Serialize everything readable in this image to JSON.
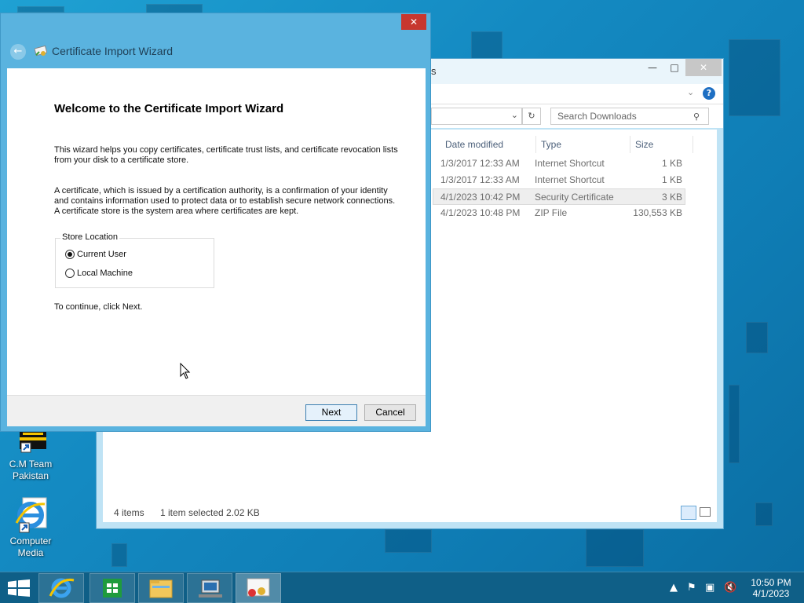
{
  "desktop": {
    "icons": [
      {
        "label_line1": "C.M Team",
        "label_line2": "Pakistan"
      },
      {
        "label_line1": "Computer",
        "label_line2": "Media"
      }
    ]
  },
  "explorer": {
    "title_fragment": "s",
    "search_placeholder": "Search Downloads",
    "columns": [
      "Date modified",
      "Type",
      "Size"
    ],
    "files": [
      {
        "date": "1/3/2017 12:33 AM",
        "type": "Internet Shortcut",
        "size": "1 KB"
      },
      {
        "date": "1/3/2017 12:33 AM",
        "type": "Internet Shortcut",
        "size": "1 KB"
      },
      {
        "date": "4/1/2023 10:42 PM",
        "type": "Security Certificate",
        "size": "3 KB"
      },
      {
        "date": "4/1/2023 10:48 PM",
        "type": "ZIP File",
        "size": "130,553 KB"
      }
    ],
    "status": {
      "items": "4 items",
      "selection": "1 item selected  2.02 KB"
    }
  },
  "wizard": {
    "title": "Certificate Import Wizard",
    "heading": "Welcome to the Certificate Import Wizard",
    "para1": "This wizard helps you copy certificates, certificate trust lists, and certificate revocation lists from your disk to a certificate store.",
    "para2": "A certificate, which is issued by a certification authority, is a confirmation of your identity and contains information used to protect data or to establish secure network connections. A certificate store is the system area where certificates are kept.",
    "store_location_label": "Store Location",
    "options": [
      "Current User",
      "Local Machine"
    ],
    "selected_option": "Current User",
    "continue_text": "To continue, click Next.",
    "next_label": "Next",
    "cancel_label": "Cancel"
  },
  "taskbar": {
    "time": "10:50 PM",
    "date": "4/1/2023"
  },
  "colors": {
    "desktop": "#148ac2",
    "wizard_frame": "#5ab3df",
    "close_red": "#c7372f",
    "taskbar": "#0f5f87"
  }
}
